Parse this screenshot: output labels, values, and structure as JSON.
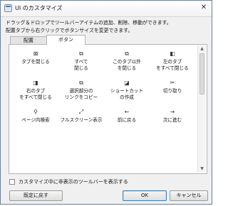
{
  "window": {
    "title": "UI のカスタマイズ",
    "close_glyph": "✕"
  },
  "description": {
    "line1": "ドラッグ＆ドロップでツールバーアイテムの追加、削除、移動ができます。",
    "line2": "配置タブから右クリックでボタンサイズを変更できます。"
  },
  "tabs": [
    {
      "label": "配置",
      "active": false
    },
    {
      "label": "ボタン",
      "active": true
    }
  ],
  "items": [
    {
      "label1": "タブを閉じる",
      "label2": "",
      "icon": "close-tab-icon",
      "glyph": "⊠"
    },
    {
      "label1": "すべて",
      "label2": "閉じる",
      "icon": "close-all-icon",
      "glyph": "⧉"
    },
    {
      "label1": "このタブ以外",
      "label2": "を閉じる",
      "icon": "close-others-icon",
      "glyph": "⧉"
    },
    {
      "label1": "左のタブ",
      "label2": "をすべて閉じる",
      "icon": "close-left-icon",
      "glyph": "◧"
    },
    {
      "label1": "右のタブ",
      "label2": "をすべて閉じる",
      "icon": "close-right-icon",
      "glyph": "◨"
    },
    {
      "label1": "選択部分の",
      "label2": "リンクをコピー",
      "icon": "copy-links-icon",
      "glyph": "⧉"
    },
    {
      "label1": "ショートカット",
      "label2": "の作成",
      "icon": "shortcut-icon",
      "glyph": "◪"
    },
    {
      "label1": "切り取り",
      "label2": "",
      "icon": "scissors-icon",
      "glyph": "✂"
    },
    {
      "label1": "ページ内検索",
      "label2": "",
      "icon": "search-icon",
      "glyph": "⚲"
    },
    {
      "label1": "フルスクリーン表示",
      "label2": "",
      "icon": "fullscreen-icon",
      "glyph": "⤢"
    },
    {
      "label1": "前に戻る",
      "label2": "",
      "icon": "back-arrow-icon",
      "glyph": "←"
    },
    {
      "label1": "次に進む",
      "label2": "",
      "icon": "forward-arrow-icon",
      "glyph": "→"
    }
  ],
  "checkbox": {
    "label": "カスタマイズ中に非表示のツールバーを表示する",
    "checked": false
  },
  "buttons": {
    "reset": "既定に戻す",
    "ok": "OK",
    "cancel": "キャンセル"
  },
  "scroll_glyphs": {
    "up": "▲",
    "down": "▼"
  }
}
